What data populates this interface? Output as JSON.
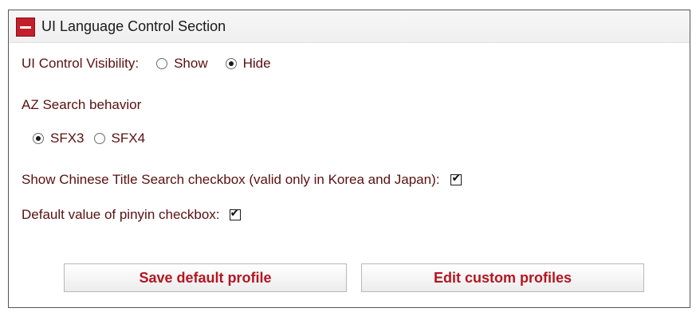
{
  "section": {
    "title": "UI Language Control Section",
    "collapse_icon": "minus-icon"
  },
  "ui_control_visibility": {
    "label": "UI Control Visibility:",
    "options": [
      {
        "label": "Show",
        "checked": false
      },
      {
        "label": "Hide",
        "checked": true
      }
    ]
  },
  "az_search": {
    "label": "AZ Search behavior",
    "options": [
      {
        "label": "SFX3",
        "checked": true
      },
      {
        "label": "SFX4",
        "checked": false
      }
    ]
  },
  "chinese_title_search": {
    "label": "Show Chinese Title Search checkbox (valid only in Korea and Japan):",
    "checked": true
  },
  "pinyin": {
    "label": "Default value of pinyin checkbox:",
    "checked": true
  },
  "buttons": {
    "save": "Save default profile",
    "edit": "Edit custom profiles"
  },
  "colors": {
    "accent": "#c41e2a",
    "label_text": "#5a1010",
    "button_text": "#b31622"
  }
}
